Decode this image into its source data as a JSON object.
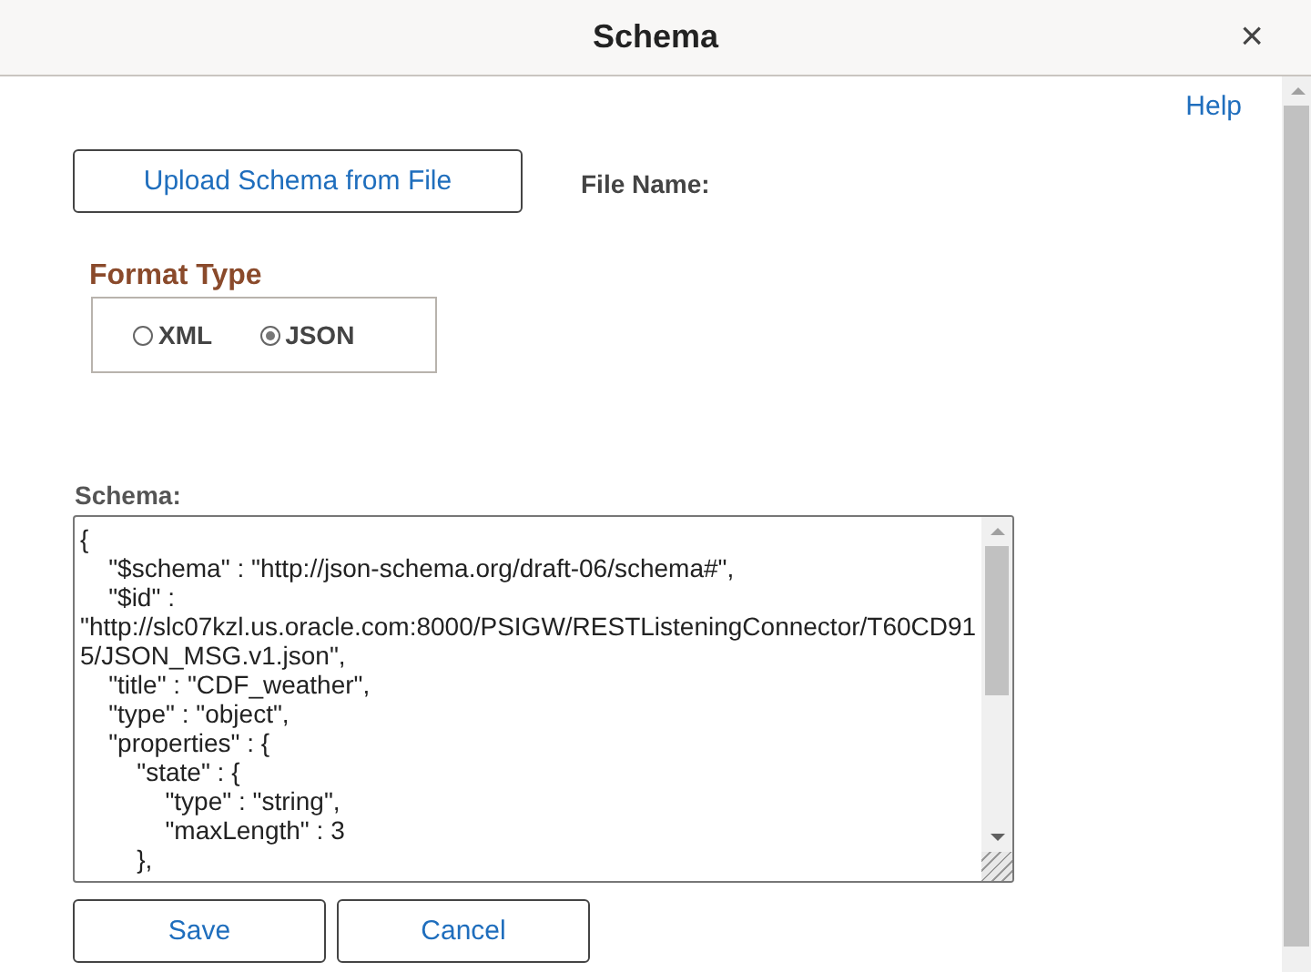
{
  "dialog": {
    "title": "Schema",
    "close": "×"
  },
  "help_link": "Help",
  "upload_button": "Upload Schema from File",
  "file_name_label": "File Name:",
  "format_type": {
    "label": "Format Type",
    "options": [
      {
        "label": "XML",
        "selected": false
      },
      {
        "label": "JSON",
        "selected": true
      }
    ]
  },
  "schema": {
    "label": "Schema:",
    "value": "{\n    \"$schema\" : \"http://json-schema.org/draft-06/schema#\",\n    \"$id\" : \n\"http://slc07kzl.us.oracle.com:8000/PSIGW/RESTListeningConnector/T60CD915/JSON_MSG.v1.json\",\n    \"title\" : \"CDF_weather\",\n    \"type\" : \"object\",\n    \"properties\" : {\n        \"state\" : {\n            \"type\" : \"string\",\n            \"maxLength\" : 3\n        },"
  },
  "buttons": [
    "Save",
    "Cancel"
  ]
}
